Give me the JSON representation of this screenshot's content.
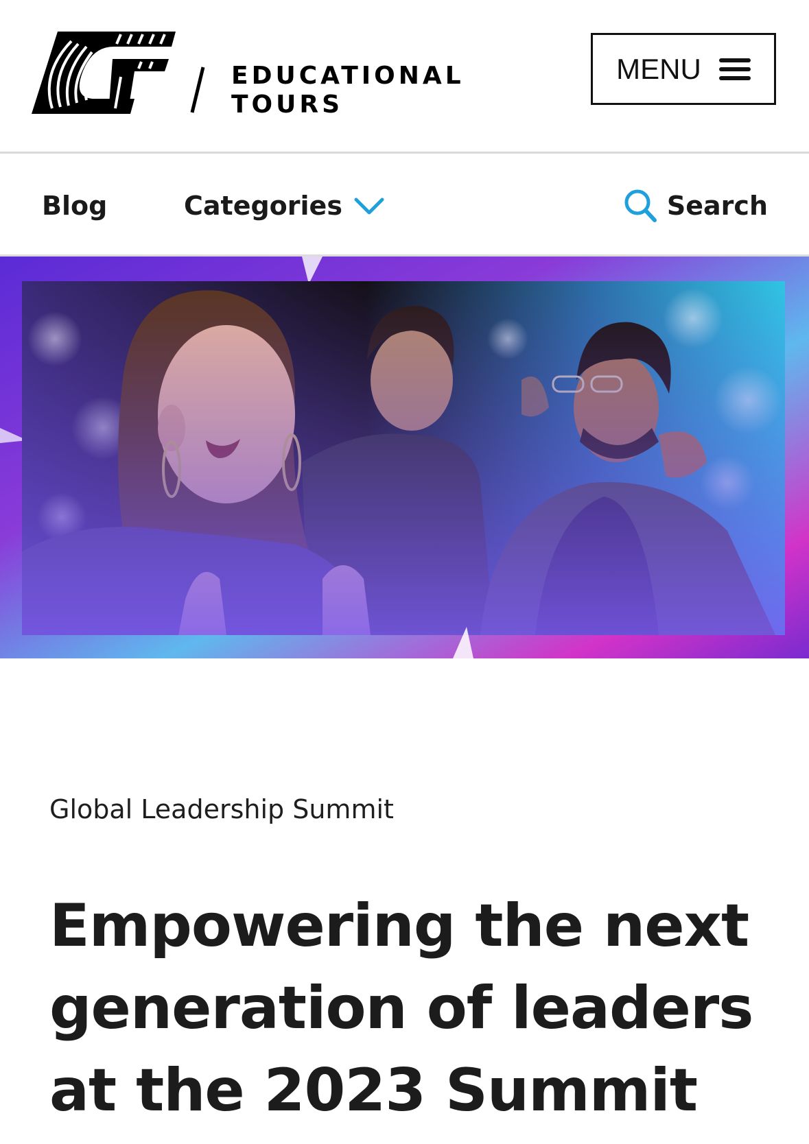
{
  "header": {
    "brand_line1": "EDUCATIONAL",
    "brand_line2": "TOURS",
    "menu_label": "MENU"
  },
  "subnav": {
    "blog_label": "Blog",
    "categories_label": "Categories",
    "search_label": "Search"
  },
  "hero": {
    "alt": "Three speakers on stage at the summit"
  },
  "article": {
    "category": "Global Leadership Summit",
    "title": "Empowering the next generation of leaders at the 2023 Summit"
  },
  "colors": {
    "accent": "#1fa0dc",
    "text": "#1c1c1c",
    "divider": "#d9d9d9"
  }
}
